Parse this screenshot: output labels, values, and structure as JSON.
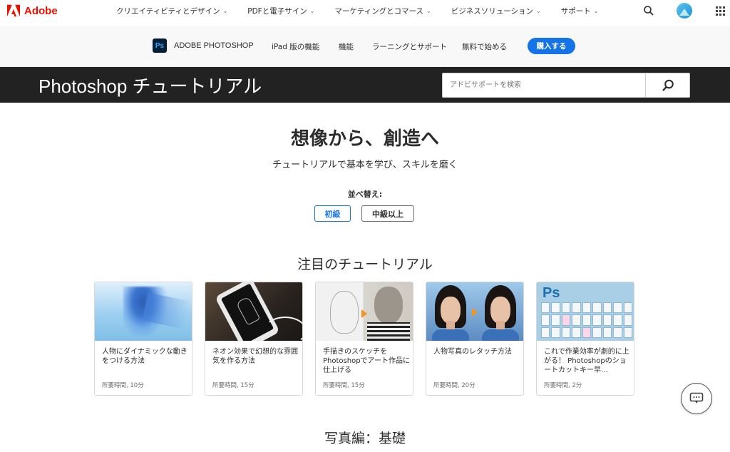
{
  "global_nav": {
    "brand": "Adobe",
    "menu": [
      "クリエイティビティとデザイン",
      "PDFと電子サイン",
      "マーケティングとコマース",
      "ビジネスソリューション",
      "サポート"
    ]
  },
  "local_nav": {
    "product_badge": "Ps",
    "product_title": "ADOBE PHOTOSHOP",
    "links": [
      "iPad 版の機能",
      "機能",
      "ラーニングとサポート",
      "無料で始める"
    ],
    "buy_label": "購入する"
  },
  "banner": {
    "title": "Photoshop チュートリアル",
    "search_placeholder": "アドビサポートを検索"
  },
  "hero": {
    "title": "想像から、創造へ",
    "subtitle": "チュートリアルで基本を学び、スキルを磨く",
    "sort_label": "並べ替え:",
    "sort_options": [
      "初級",
      "中級以上"
    ],
    "sort_selected": "初級"
  },
  "featured": {
    "title": "注目のチュートリアル",
    "cards": [
      {
        "title": "人物にダイナミックな動きをつける方法",
        "meta": "所要時間, 10分"
      },
      {
        "title": "ネオン効果で幻想的な雰囲気を作る方法",
        "meta": "所要時間, 15分"
      },
      {
        "title": "手描きのスケッチをPhotoshopでアート作品に仕上げる",
        "meta": "所要時間, 15分"
      },
      {
        "title": "人物写真のレタッチ方法",
        "meta": "所要時間, 20分"
      },
      {
        "title": "これで作業効率が劇的に上がる！ Photoshopのショートカットキー早…",
        "meta": "所要時間, 2分"
      }
    ]
  },
  "next_section": {
    "title": "写真編：基礎"
  },
  "colors": {
    "adobe_red": "#eb1000",
    "accent_blue": "#1473e6",
    "banner_bg": "#222222"
  }
}
